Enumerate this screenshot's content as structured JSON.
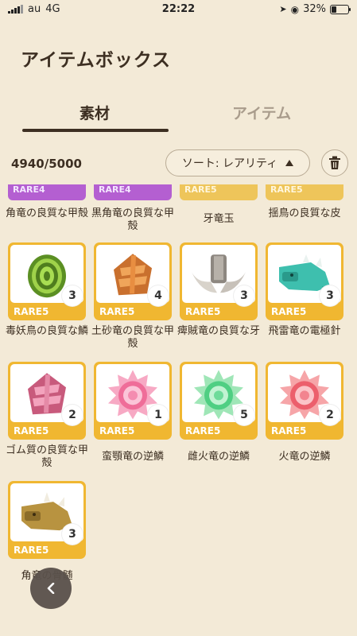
{
  "status": {
    "carrier": "au",
    "network": "4G",
    "time": "22:22",
    "battery": "32%",
    "battery_level": 0.32
  },
  "title": "アイテムボックス",
  "tabs": [
    {
      "label": "素材",
      "selected": true
    },
    {
      "label": "アイテム",
      "selected": false
    }
  ],
  "toolbar": {
    "count": "4940/5000",
    "sort_label": "ソート: レアリティ"
  },
  "top_row": [
    {
      "rare": "RARE4",
      "name": "角竜の良質な甲殻"
    },
    {
      "rare": "RARE4",
      "name": "黒角竜の良質な甲殻"
    },
    {
      "rare": "RARE5",
      "name": "牙竜玉"
    },
    {
      "rare": "RARE5",
      "name": "揺鳥の良質な皮"
    }
  ],
  "items": [
    {
      "name": "毒妖鳥の良質な鱗",
      "rare": "RARE5",
      "qty": "3",
      "icon": "green-scale-icon"
    },
    {
      "name": "土砂竜の良質な甲殻",
      "rare": "RARE5",
      "qty": "4",
      "icon": "orange-shell-icon"
    },
    {
      "name": "痺賊竜の良質な牙",
      "rare": "RARE5",
      "qty": "3",
      "icon": "fang-icon"
    },
    {
      "name": "飛雷竜の電極針",
      "rare": "RARE5",
      "qty": "3",
      "icon": "teal-monster-icon"
    },
    {
      "name": "ゴム質の良質な甲殻",
      "rare": "RARE5",
      "qty": "2",
      "icon": "pink-shell-icon"
    },
    {
      "name": "蛮顎竜の逆鱗",
      "rare": "RARE5",
      "qty": "1",
      "icon": "pink-gem-icon"
    },
    {
      "name": "雌火竜の逆鱗",
      "rare": "RARE5",
      "qty": "5",
      "icon": "green-gem-icon"
    },
    {
      "name": "火竜の逆鱗",
      "rare": "RARE5",
      "qty": "2",
      "icon": "red-gem-icon"
    },
    {
      "name": "角竜の骨髄",
      "rare": "RARE5",
      "qty": "3",
      "icon": "brown-monster-icon"
    }
  ],
  "colors": {
    "background": "#f3ead7",
    "rare5": "#f0b731",
    "rare4": "#b45fd1",
    "text": "#3d2f22"
  }
}
